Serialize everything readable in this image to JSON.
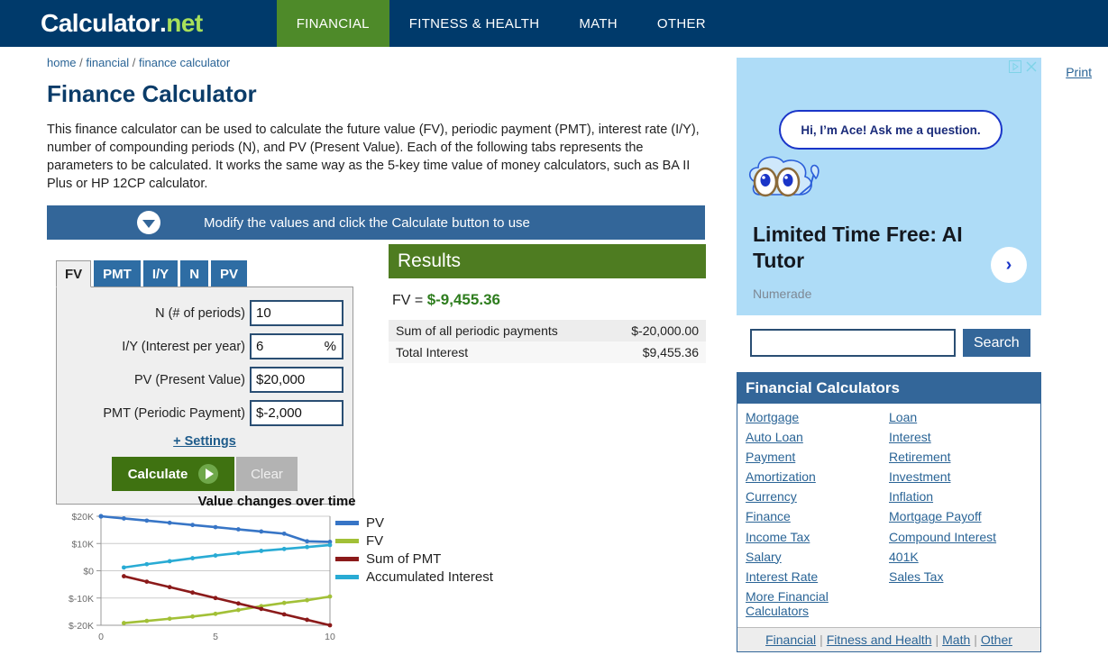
{
  "header": {
    "logo_main": "Calculator",
    "logo_dot": ".",
    "logo_net": "net",
    "nav": [
      {
        "label": "FINANCIAL",
        "active": true
      },
      {
        "label": "FITNESS & HEALTH",
        "active": false
      },
      {
        "label": "MATH",
        "active": false
      },
      {
        "label": "OTHER",
        "active": false
      }
    ]
  },
  "breadcrumb": {
    "home": "home",
    "financial": "financial",
    "current": "finance calculator",
    "sep": "/"
  },
  "print_label": "Print",
  "page_title": "Finance Calculator",
  "intro": "This finance calculator can be used to calculate the future value (FV), periodic payment (PMT), interest rate (I/Y), number of compounding periods (N), and PV (Present Value). Each of the following tabs represents the parameters to be calculated. It works the same way as the 5-key time value of money calculators, such as BA II Plus or HP 12CP calculator.",
  "modify_bar": "Modify the values and click the Calculate button to use",
  "calculator": {
    "tabs": [
      {
        "label": "FV",
        "active": true
      },
      {
        "label": "PMT",
        "active": false
      },
      {
        "label": "I/Y",
        "active": false
      },
      {
        "label": "N",
        "active": false
      },
      {
        "label": "PV",
        "active": false
      }
    ],
    "fields": [
      {
        "label": "N (# of periods)",
        "value": "10",
        "suffix": ""
      },
      {
        "label": "I/Y (Interest per year)",
        "value": "6",
        "suffix": "%"
      },
      {
        "label": "PV (Present Value)",
        "value": "$20,000",
        "suffix": ""
      },
      {
        "label": "PMT (Periodic Payment)",
        "value": "$-2,000",
        "suffix": ""
      }
    ],
    "settings_label": "+ Settings",
    "calculate_label": "Calculate",
    "clear_label": "Clear"
  },
  "results": {
    "heading": "Results",
    "fv_prefix": "FV = ",
    "fv_value": "$-9,455.36",
    "rows": [
      {
        "label": "Sum of all periodic payments",
        "value": "$-20,000.00"
      },
      {
        "label": "Total Interest",
        "value": "$9,455.36"
      }
    ]
  },
  "chart_data": {
    "type": "line",
    "title": "Value changes over time",
    "xlabel": "",
    "ylabel": "",
    "x": [
      1,
      2,
      3,
      4,
      5,
      6,
      7,
      8,
      9,
      10
    ],
    "xlim": [
      0,
      10
    ],
    "ylim": [
      -20000,
      20000
    ],
    "xticks": [
      "0",
      "5",
      "10"
    ],
    "yticks": [
      "$20K",
      "$10K",
      "$0",
      "$-10K",
      "$-20K"
    ],
    "ytick_values": [
      20000,
      10000,
      0,
      -10000,
      -20000
    ],
    "grid": true,
    "legend_position": "right",
    "series": [
      {
        "name": "PV",
        "color": "#3775C6",
        "values": [
          19200,
          18400,
          17600,
          16800,
          16000,
          15200,
          14400,
          13600,
          10800,
          10600
        ]
      },
      {
        "name": "FV",
        "color": "#A2C037",
        "values": [
          -19200,
          -18400,
          -17600,
          -16800,
          -15800,
          -14400,
          -13000,
          -11800,
          -10800,
          -9455
        ]
      },
      {
        "name": "Sum of PMT",
        "color": "#8B1A1A",
        "values": [
          -2000,
          -4000,
          -6000,
          -8000,
          -10000,
          -12000,
          -14000,
          -16000,
          -18000,
          -20000
        ]
      },
      {
        "name": "Accumulated Interest",
        "color": "#29ABD4",
        "values": [
          1200,
          2400,
          3500,
          4600,
          5600,
          6500,
          7300,
          8000,
          8700,
          9455
        ]
      }
    ]
  },
  "ad": {
    "bubble": "Hi, I’m Ace! Ask me a question.",
    "title": "Limited Time Free: AI Tutor",
    "advertiser": "Numerade"
  },
  "search": {
    "value": "",
    "placeholder": "",
    "button_label": "Search"
  },
  "sidebox": {
    "heading": "Financial Calculators",
    "col1": [
      "Mortgage",
      "Auto Loan",
      "Payment",
      "Amortization",
      "Currency",
      "Finance",
      "Income Tax",
      "Salary",
      "Interest Rate",
      "More Financial Calculators"
    ],
    "col2": [
      "Loan",
      "Interest",
      "Retirement",
      "Investment",
      "Inflation",
      "Mortgage Payoff",
      "Compound Interest",
      "401K",
      "Sales Tax"
    ],
    "footer": [
      "Financial",
      "Fitness and Health",
      "Math",
      "Other"
    ]
  }
}
